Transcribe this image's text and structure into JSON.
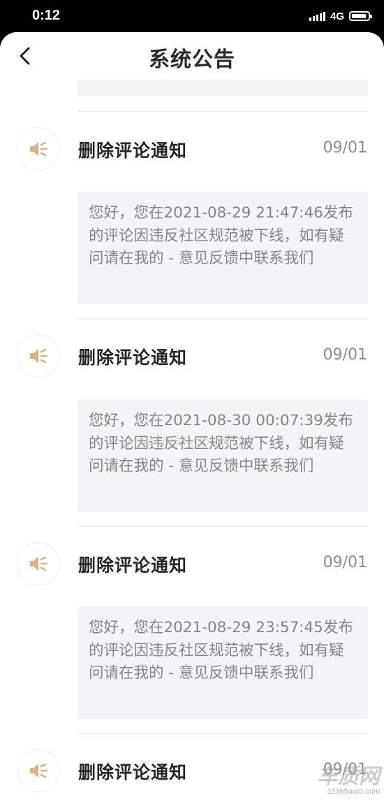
{
  "status_bar": {
    "time": "0:12",
    "network": "4G"
  },
  "nav": {
    "title": "系统公告"
  },
  "notices": [
    {
      "title": "删除评论通知",
      "date": "09/01",
      "body": "您好，您在2021-08-29 21:47:46发布的评论因违反社区规范被下线，如有疑问请在我的 - 意见反馈中联系我们"
    },
    {
      "title": "删除评论通知",
      "date": "09/01",
      "body": "您好，您在2021-08-30 00:07:39发布的评论因违反社区规范被下线，如有疑问请在我的 - 意见反馈中联系我们"
    },
    {
      "title": "删除评论通知",
      "date": "09/01",
      "body": "您好，您在2021-08-29 23:57:45发布的评论因违反社区规范被下线，如有疑问请在我的 - 意见反馈中联系我们"
    },
    {
      "title": "删除评论通知",
      "date": "09/01"
    }
  ],
  "watermark": "www.12365auto.com",
  "corner_logo": {
    "main": "车质网",
    "sub": "12365auto.com"
  },
  "icons": {
    "notice": "speaker-icon",
    "back": "back-chevron-icon"
  },
  "colors": {
    "accent": "#d9b383",
    "card_background": "#f3f4f6",
    "title_text": "#262626",
    "body_text": "#858585",
    "date_text": "#8c8c8c"
  }
}
